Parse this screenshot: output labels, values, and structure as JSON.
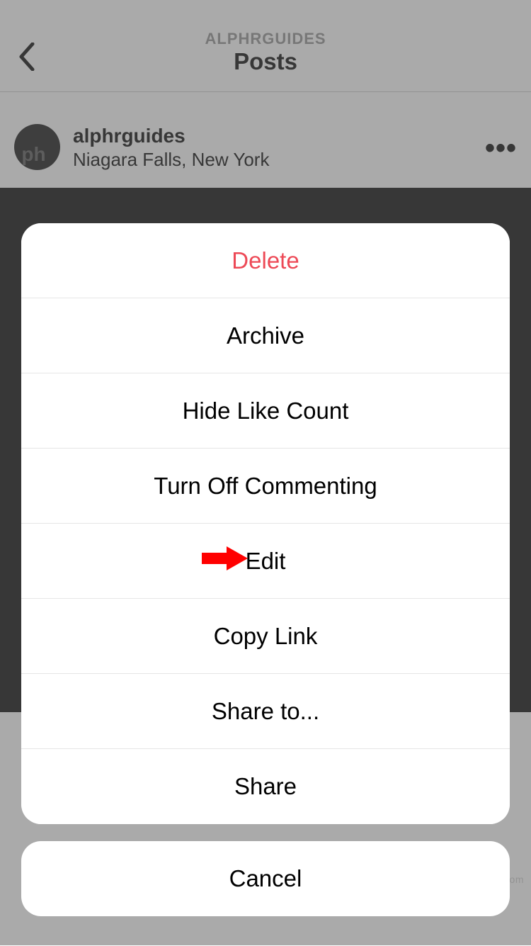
{
  "header": {
    "subtitle": "ALPHRGUIDES",
    "title": "Posts"
  },
  "post": {
    "username": "alphrguides",
    "location": "Niagara Falls, New York",
    "avatar_text": "ph",
    "more_icon": "•••"
  },
  "action_sheet": {
    "items": [
      {
        "label": "Delete",
        "destructive": true
      },
      {
        "label": "Archive",
        "destructive": false
      },
      {
        "label": "Hide Like Count",
        "destructive": false
      },
      {
        "label": "Turn Off Commenting",
        "destructive": false
      },
      {
        "label": "Edit",
        "destructive": false,
        "annotated": true
      },
      {
        "label": "Copy Link",
        "destructive": false
      },
      {
        "label": "Share to...",
        "destructive": false
      },
      {
        "label": "Share",
        "destructive": false
      }
    ],
    "cancel_label": "Cancel"
  },
  "watermark": "www.deuaq.com"
}
